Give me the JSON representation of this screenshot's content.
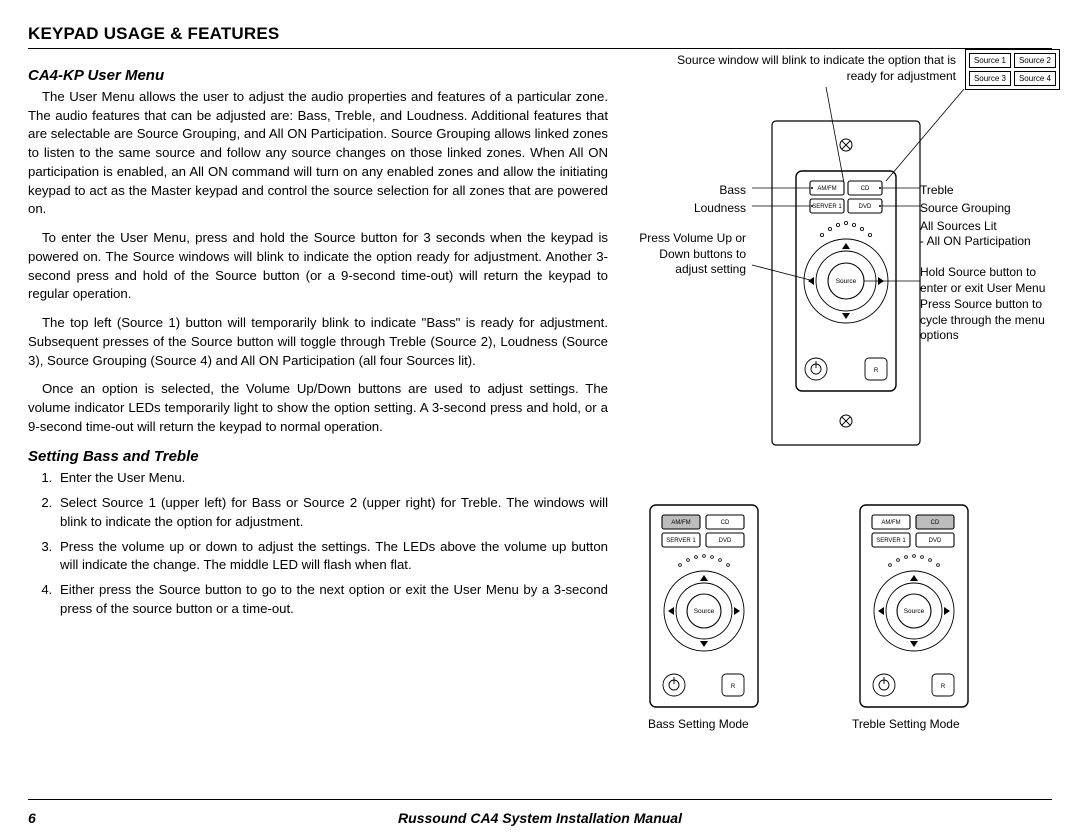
{
  "header": "KEYPAD USAGE & FEATURES",
  "section1_title": "CA4-KP User Menu",
  "p1": "The User Menu allows the user to adjust the audio properties and features of a particular zone. The audio features that can be adjusted are: Bass, Treble, and Loudness. Additional features that are selectable are Source Grouping, and All ON Participation. Source Grouping allows linked zones to listen to the same source and follow any source changes on those linked zones. When All ON participation is enabled, an All ON command will turn on any enabled zones and allow the initiating keypad to act as the Master keypad and control the source selection for all zones that are powered on.",
  "p2": "To enter the User Menu, press and hold the Source button for 3 seconds when the keypad is powered on. The Source windows will blink to indicate the option ready for adjustment. Another 3-second press and hold of the Source button (or a  9-second time-out) will return the keypad to regular operation.",
  "p3": "The top left (Source 1) button will temporarily blink to indicate \"Bass\" is ready for adjustment. Subsequent presses of the Source button will toggle through Treble (Source 2), Loudness (Source 3), Source Grouping (Source 4) and All ON Participation (all four Sources lit).",
  "p4": "Once an option is selected, the Volume Up/Down buttons are used to adjust settings. The volume indicator LEDs temporarily light to show the option setting. A 3-second press and hold, or a 9-second time-out will return the keypad to normal operation.",
  "section2_title": "Setting Bass and Treble",
  "step1": "Enter the User Menu.",
  "step2": "Select Source 1 (upper left) for Bass or Source 2 (upper right) for Treble. The windows will blink to indicate the option for adjustment.",
  "step3": "Press the volume up or down to adjust the settings. The LEDs above the volume up button will indicate the change. The middle LED will flash when flat.",
  "step4": "Either press the Source button to go to the next option or exit the User Menu by a 3-second press of the source button or a time-out.",
  "page_number": "6",
  "footer_title": "Russound CA4 System Installation Manual",
  "diag": {
    "callout_top": "Source window will blink to indicate the option that is ready for adjustment",
    "src1": "Source 1",
    "src2": "Source 2",
    "src3": "Source 3",
    "src4": "Source 4",
    "bass": "Bass",
    "treble": "Treble",
    "loudness": "Loudness",
    "srcgroup": "Source Grouping",
    "allsources": "All Sources Lit",
    "allon": "- All ON Participation",
    "volnote": "Press Volume Up or Down buttons to adjust setting",
    "hold1": "Hold Source button to enter or exit User Menu",
    "hold2": "Press Source button to cycle through the menu options",
    "bassmode": "Bass Setting Mode",
    "treblemode": "Treble Setting Mode",
    "btn_amfm": "AM/FM",
    "btn_cd": "CD",
    "btn_server": "SERVER 1",
    "btn_dvd": "DVD",
    "btn_source": "Source"
  }
}
